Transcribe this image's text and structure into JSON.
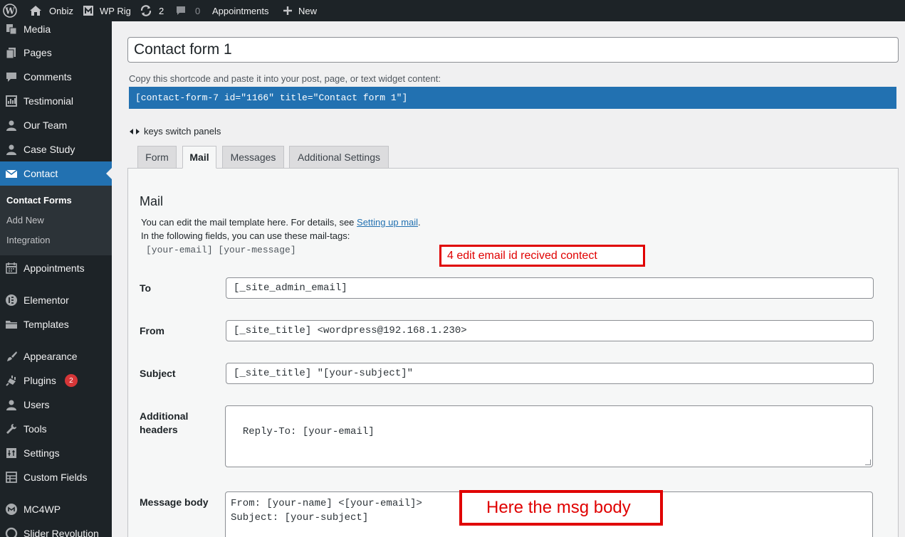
{
  "adminbar": {
    "site_name": "Onbiz",
    "theme_name": "WP Rig",
    "updates_count": "2",
    "comments_count": "0",
    "appointments_label": "Appointments",
    "new_label": "New"
  },
  "sidebar": {
    "items": [
      {
        "label": "Media",
        "icon": "media-icon"
      },
      {
        "label": "Pages",
        "icon": "pages-icon"
      },
      {
        "label": "Comments",
        "icon": "comments-icon"
      },
      {
        "label": "Testimonial",
        "icon": "testimonial-icon"
      },
      {
        "label": "Our Team",
        "icon": "user-icon"
      },
      {
        "label": "Case Study",
        "icon": "user-icon"
      },
      {
        "label": "Contact",
        "icon": "mail-icon"
      },
      {
        "label": "Appointments",
        "icon": "calendar-icon"
      },
      {
        "label": "Elementor",
        "icon": "elementor-icon"
      },
      {
        "label": "Templates",
        "icon": "folder-icon"
      },
      {
        "label": "Appearance",
        "icon": "brush-icon"
      },
      {
        "label": "Plugins",
        "icon": "plugin-icon",
        "badge": "2"
      },
      {
        "label": "Users",
        "icon": "user-icon"
      },
      {
        "label": "Tools",
        "icon": "wrench-icon"
      },
      {
        "label": "Settings",
        "icon": "settings-icon"
      },
      {
        "label": "Custom Fields",
        "icon": "table-icon"
      },
      {
        "label": "MC4WP",
        "icon": "mc4wp-icon"
      },
      {
        "label": "Slider Revolution",
        "icon": "slider-icon"
      }
    ],
    "submenu": [
      "Contact Forms",
      "Add New",
      "Integration"
    ]
  },
  "form": {
    "title": "Contact form 1",
    "shortcode_hint": "Copy this shortcode and paste it into your post, page, or text widget content:",
    "shortcode": "[contact-form-7 id=\"1166\" title=\"Contact form 1\"]",
    "keys_hint": "keys switch panels",
    "tabs": [
      "Form",
      "Mail",
      "Messages",
      "Additional Settings"
    ],
    "active_tab": "Mail"
  },
  "mail": {
    "heading": "Mail",
    "desc_prefix": "You can edit the mail template here. For details, see ",
    "desc_link": "Setting up mail",
    "desc_suffix": ".",
    "desc_line2": "In the following fields, you can use these mail-tags:",
    "mail_tags": "[your-email] [your-message]",
    "fields": {
      "to_label": "To",
      "to_value": "[_site_admin_email]",
      "from_label": "From",
      "from_value": "[_site_title] <wordpress@192.168.1.230>",
      "subject_label": "Subject",
      "subject_value": "[_site_title] \"[your-subject]\"",
      "headers_label_1": "Additional",
      "headers_label_2": "headers",
      "headers_value": "Reply-To: [your-email]",
      "body_label": "Message body",
      "body_value": "From: [your-name] <[your-email]>\nSubject: [your-subject]"
    }
  },
  "annotations": {
    "note1": "4 edit email id recived contect",
    "note2": "Here the msg body",
    "color": "#e00000"
  }
}
